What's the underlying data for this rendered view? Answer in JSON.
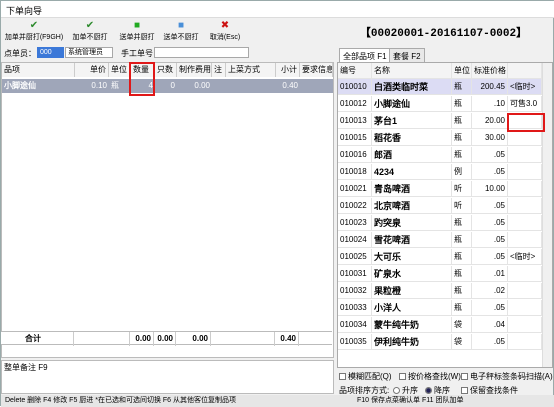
{
  "window": {
    "title": "下单向导"
  },
  "toolbar": [
    {
      "label": "加单并厨打(F9GH)",
      "icon": "check-icon",
      "glyph": "✔",
      "color": "#2e8b2e"
    },
    {
      "label": "加单不厨打",
      "icon": "check-icon",
      "glyph": "✔",
      "color": "#2e8b2e"
    },
    {
      "label": "送单并厨打",
      "icon": "green-square-icon",
      "glyph": "■",
      "color": "#22aa22"
    },
    {
      "label": "送单不厨打",
      "icon": "blue-square-icon",
      "glyph": "■",
      "color": "#4a8fd8"
    },
    {
      "label": "取消(Esc)",
      "icon": "close-icon",
      "glyph": "✖",
      "color": "#cc1111"
    }
  ],
  "order_code": "【00020001-20161107-0002】",
  "form": {
    "dish_label": "点单员：",
    "dish_value": "000",
    "user_value": "系统管理员",
    "manual_label": "手工单号：",
    "manual_value": ""
  },
  "left_table": {
    "headers": [
      "品项",
      "单价",
      "单位",
      "数量",
      "只数",
      "制作费用",
      "注",
      "上菜方式",
      "小计",
      "要求信息"
    ],
    "rows": [
      {
        "name": "小脚途仙",
        "price": "0.10",
        "unit": "瓶",
        "qty": "4",
        "count": "0",
        "fee": "0.00",
        "note": "",
        "method": "",
        "subtotal": "0.40",
        "req": ""
      }
    ],
    "footer": {
      "label": "合计",
      "qty": "0.00",
      "count": "0.00",
      "fee": "0.00",
      "subtotal": "0.40"
    }
  },
  "remark_label": "整单备注 F9",
  "right_panel": {
    "tabs": [
      "全部品项 F1",
      "套餐 F2"
    ],
    "headers": [
      "编号",
      "名称",
      "单位",
      "标准价格",
      ""
    ],
    "rows": [
      {
        "code": "010010",
        "name": "白酒类临时菜",
        "unit": "瓶",
        "price": "200.45",
        "tag": "<临时>"
      },
      {
        "code": "010012",
        "name": "小脚途仙",
        "unit": "瓶",
        "price": ".10",
        "tag": "可售3.0"
      },
      {
        "code": "010013",
        "name": "茅台1",
        "unit": "瓶",
        "price": "20.00",
        "tag": ""
      },
      {
        "code": "010015",
        "name": "稻花香",
        "unit": "瓶",
        "price": "30.00",
        "tag": ""
      },
      {
        "code": "010016",
        "name": "郎酒",
        "unit": "瓶",
        "price": ".05",
        "tag": ""
      },
      {
        "code": "010018",
        "name": "4234",
        "unit": "例",
        "price": ".05",
        "tag": ""
      },
      {
        "code": "010021",
        "name": "青岛啤酒",
        "unit": "听",
        "price": "10.00",
        "tag": ""
      },
      {
        "code": "010022",
        "name": "北京啤酒",
        "unit": "听",
        "price": ".05",
        "tag": ""
      },
      {
        "code": "010023",
        "name": "趵突泉",
        "unit": "瓶",
        "price": ".05",
        "tag": ""
      },
      {
        "code": "010024",
        "name": "雪花啤酒",
        "unit": "瓶",
        "price": ".05",
        "tag": ""
      },
      {
        "code": "010025",
        "name": "大可乐",
        "unit": "瓶",
        "price": ".05",
        "tag": "<临时>"
      },
      {
        "code": "010031",
        "name": "矿泉水",
        "unit": "瓶",
        "price": ".01",
        "tag": ""
      },
      {
        "code": "010032",
        "name": "果粒橙",
        "unit": "瓶",
        "price": ".02",
        "tag": ""
      },
      {
        "code": "010033",
        "name": "小洋人",
        "unit": "瓶",
        "price": ".05",
        "tag": ""
      },
      {
        "code": "010034",
        "name": "蒙牛纯牛奶",
        "unit": "袋",
        "price": ".04",
        "tag": ""
      },
      {
        "code": "010035",
        "name": "伊利纯牛奶",
        "unit": "袋",
        "price": ".05",
        "tag": ""
      }
    ]
  },
  "options": {
    "fuzzy": "模糊匹配(Q)",
    "by_price": "按价格查找(W)",
    "pinyin": "电子秤标签条码扫描(A)",
    "sort_label": "品项排序方式:",
    "asc": "升序",
    "desc": "降序",
    "keep": "保留查找条件"
  },
  "status_bar": {
    "left": "Delete 删除  F4 修改  F5 厨进  *在已选和可选间切换  F6 从其他客位复制品项",
    "right": "F10 保存点菜确认单  F11 团队加单"
  }
}
